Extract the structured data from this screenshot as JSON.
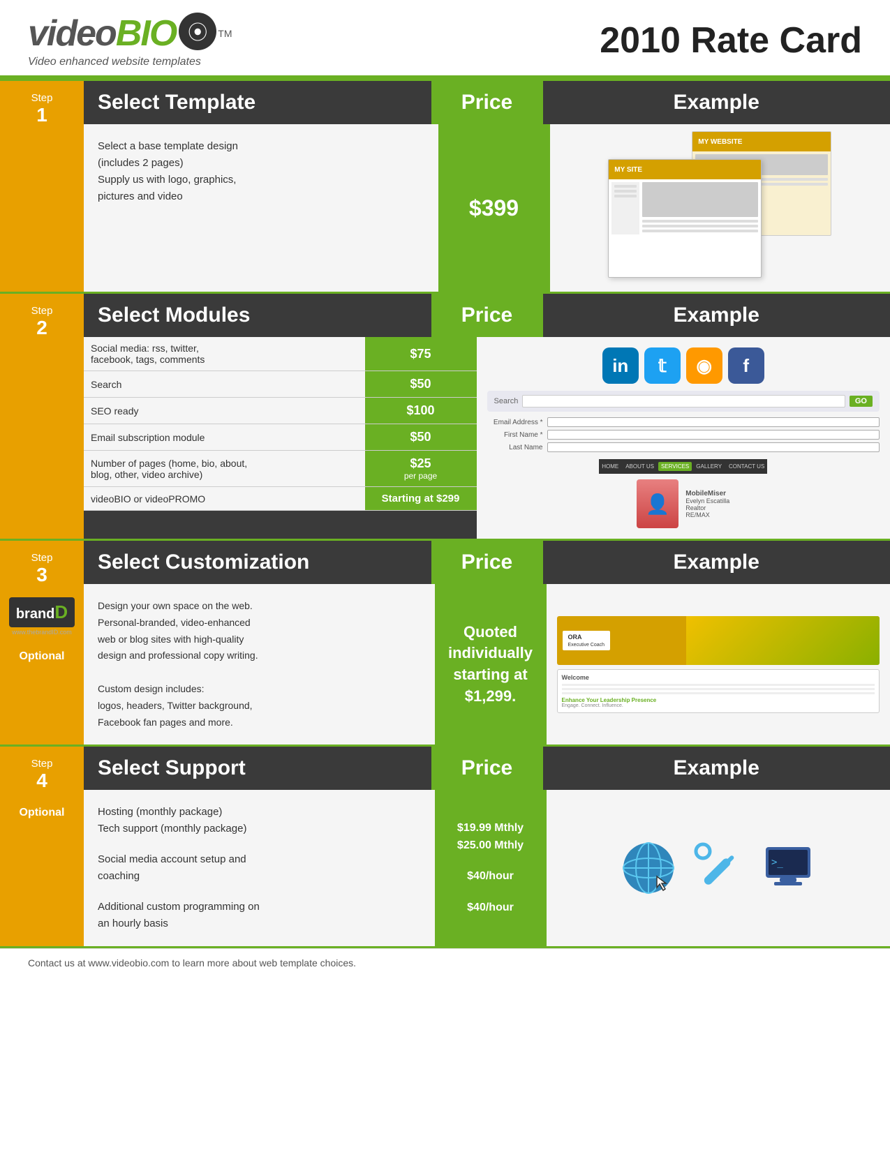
{
  "header": {
    "logo_video": "video",
    "logo_bio": "BIO",
    "logo_tm": "TM",
    "logo_tagline": "Video enhanced website templates",
    "rate_card_title": "2010 Rate Card"
  },
  "step1": {
    "step_label": "Step",
    "step_num": "1",
    "header_title": "Select Template",
    "header_price": "Price",
    "header_example": "Example",
    "details_line1": "Select a base template design",
    "details_line2": "(includes 2 pages)",
    "details_line3": "Supply us with logo, graphics,",
    "details_line4": "pictures and video",
    "price": "$399"
  },
  "step2": {
    "step_label": "Step",
    "step_num": "2",
    "header_title": "Select Modules",
    "header_price": "Price",
    "header_example": "Example",
    "modules": [
      {
        "name": "Social media: rss, twitter, facebook, tags, comments",
        "price": "$75",
        "per": ""
      },
      {
        "name": "Search",
        "price": "$50",
        "per": ""
      },
      {
        "name": "SEO ready",
        "price": "$100",
        "per": ""
      },
      {
        "name": "Email subscription module",
        "price": "$50",
        "per": ""
      },
      {
        "name": "Number of pages (home, bio, about, blog, other, video archive)",
        "price": "$25",
        "per": "per page"
      },
      {
        "name": "videoBIO or videoPROMO",
        "price": "Starting at $299",
        "per": ""
      }
    ]
  },
  "step3": {
    "step_label": "Step",
    "step_num": "3",
    "optional": "Optional",
    "header_title": "Select Customization",
    "header_price": "Price",
    "header_example": "Example",
    "details": [
      "Design your own space on the web.",
      "Personal-branded, video-enhanced",
      "web or blog sites with high-quality",
      "design and professional copy writing.",
      "",
      "Custom design includes:",
      "logos, headers, Twitter background,",
      "Facebook fan pages and more."
    ],
    "price_line1": "Quoted",
    "price_line2": "individually",
    "price_line3": "starting at",
    "price_line4": "$1,299."
  },
  "step4": {
    "step_label": "Step",
    "step_num": "4",
    "optional": "Optional",
    "header_title": "Select Support",
    "header_price": "Price",
    "header_example": "Example",
    "services": [
      {
        "name": "Hosting (monthly package)",
        "price": "$19.99 Mthly"
      },
      {
        "name": "Tech support (monthly package)",
        "price": "$25.00 Mthly"
      },
      {
        "name": "Social media account setup and coaching",
        "price": "$40/hour"
      },
      {
        "name": "Additional custom programming on an hourly basis",
        "price": "$40/hour"
      }
    ]
  },
  "footer": {
    "text": "Contact us at www.videobio.com to learn more about web template choices."
  },
  "search_placeholder": "Search",
  "search_go": "GO",
  "nav_items": [
    "HOME",
    "ABOUT US",
    "SERVICES",
    "GALLERY",
    "CONTACT US"
  ],
  "form_fields": [
    "Email Address *",
    "First Name *",
    "Last Name"
  ]
}
